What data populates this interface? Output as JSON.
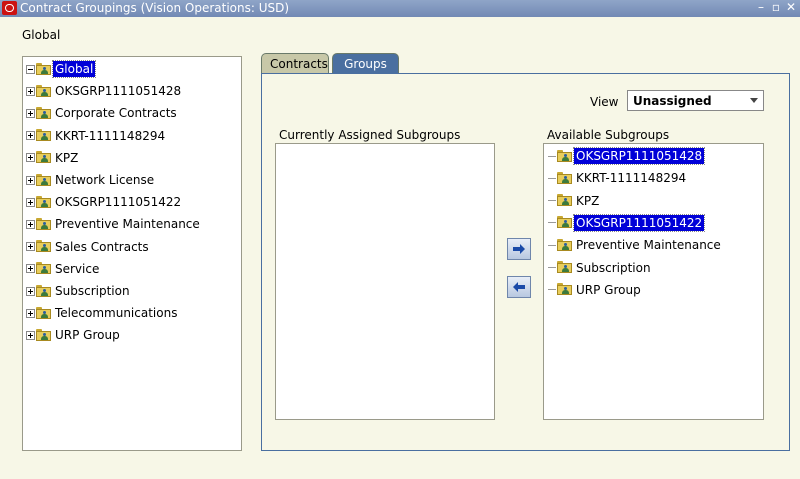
{
  "window": {
    "title": "Contract Groupings (Vision Operations: USD)"
  },
  "context_label": "Global",
  "tree": [
    {
      "label": "Global",
      "expander": "minus",
      "selected": true
    },
    {
      "label": "OKSGRP1111051428",
      "expander": "plus",
      "selected": false
    },
    {
      "label": "Corporate Contracts",
      "expander": "plus",
      "selected": false
    },
    {
      "label": "KKRT-1111148294",
      "expander": "plus",
      "selected": false
    },
    {
      "label": "KPZ",
      "expander": "plus",
      "selected": false
    },
    {
      "label": "Network License",
      "expander": "plus",
      "selected": false
    },
    {
      "label": "OKSGRP1111051422",
      "expander": "plus",
      "selected": false
    },
    {
      "label": "Preventive Maintenance",
      "expander": "plus",
      "selected": false
    },
    {
      "label": "Sales Contracts",
      "expander": "plus",
      "selected": false
    },
    {
      "label": "Service",
      "expander": "plus",
      "selected": false
    },
    {
      "label": "Subscription",
      "expander": "plus",
      "selected": false
    },
    {
      "label": "Telecommunications",
      "expander": "plus",
      "selected": false
    },
    {
      "label": "URP Group",
      "expander": "plus",
      "selected": false
    }
  ],
  "tabs": [
    {
      "label": "Contracts",
      "active": false
    },
    {
      "label": "Groups",
      "active": true
    }
  ],
  "view": {
    "label": "View",
    "value": "Unassigned"
  },
  "assigned": {
    "label": "Currently Assigned Subgroups",
    "items": []
  },
  "available": {
    "label": "Available Subgroups",
    "items": [
      {
        "label": "OKSGRP1111051428",
        "selected": true
      },
      {
        "label": "KKRT-1111148294",
        "selected": false
      },
      {
        "label": "KPZ",
        "selected": false
      },
      {
        "label": "OKSGRP1111051422",
        "selected": true
      },
      {
        "label": "Preventive Maintenance",
        "selected": false
      },
      {
        "label": "Subscription",
        "selected": false
      },
      {
        "label": "URP Group",
        "selected": false
      }
    ]
  },
  "shuttle": {
    "assign_icon": "arrow-right-icon",
    "unassign_icon": "arrow-left-icon"
  }
}
